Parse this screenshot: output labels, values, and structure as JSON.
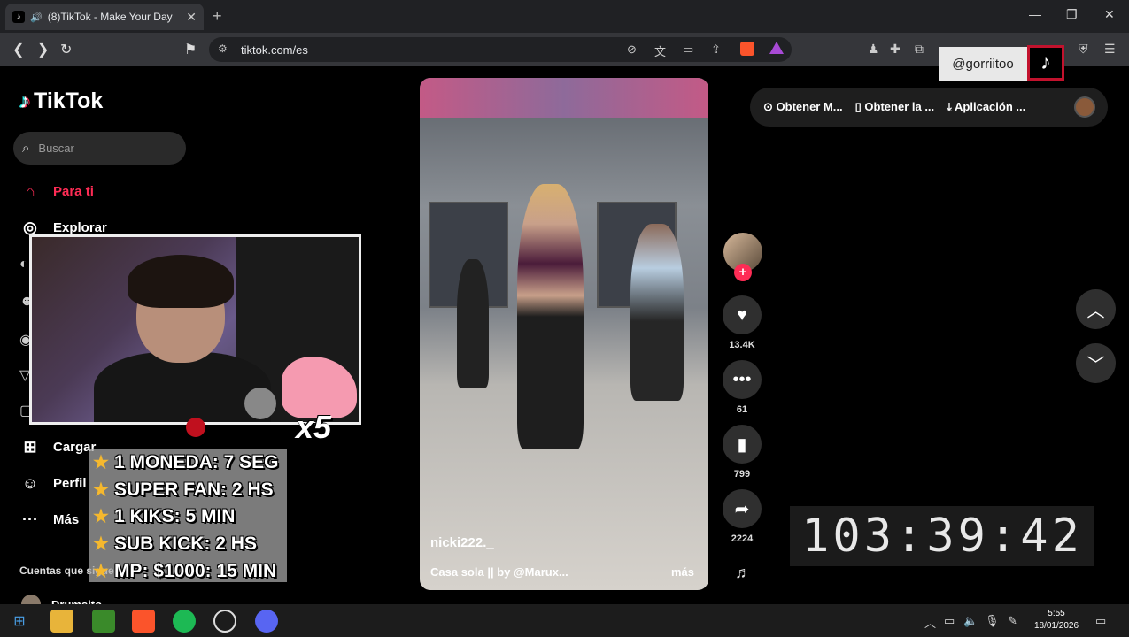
{
  "browser": {
    "tab_title": "(8)TikTok - Make Your Day",
    "tab_icon": "tiktok-icon",
    "url": "tiktok.com/es",
    "overlay_handle": "@gorriitoo"
  },
  "sidebar": {
    "brand": "TikTok",
    "search_placeholder": "Buscar",
    "items": [
      {
        "label": "Para ti",
        "icon": "home-icon"
      },
      {
        "label": "Explorar",
        "icon": "compass-icon"
      },
      {
        "label": "Cargar",
        "icon": "upload-icon"
      },
      {
        "label": "Perfil",
        "icon": "profile-avatar-icon"
      },
      {
        "label": "Más",
        "icon": "more-icon"
      }
    ],
    "following_label": "Cuentas que sigues",
    "following_first": "Drumsito"
  },
  "stream_overlay": {
    "multiplier": "x5",
    "rules": [
      "1 MONEDA: 7 SEG",
      "SUPER FAN: 2 HS",
      "1 KIKS: 5 MIN",
      "SUB KICK: 2 HS",
      "MP: $1000: 15 MIN"
    ],
    "timer": "103:39:42"
  },
  "video": {
    "author": "nicki222._",
    "sound": "Casa sola || by @Marux...",
    "more_label": "más",
    "likes": "13.4K",
    "comments": "61",
    "saves": "799",
    "shares": "2224"
  },
  "topbar": {
    "items": [
      "Obtener M...",
      "Obtener la ...",
      "Aplicación ..."
    ]
  },
  "taskbar": {
    "time": "5:55",
    "date": "18/01/2026"
  }
}
